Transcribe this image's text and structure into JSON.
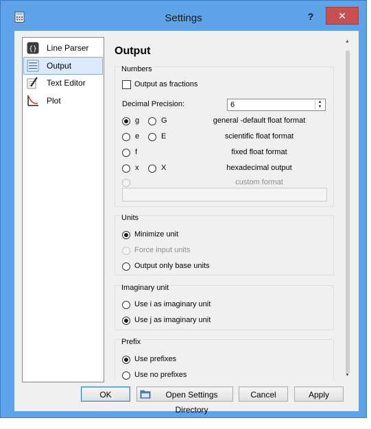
{
  "window": {
    "title": "Settings",
    "help_label": "?",
    "close_label": "✕"
  },
  "sidebar": {
    "items": [
      {
        "label": "Line Parser",
        "icon": "function-brackets-icon",
        "selected": false
      },
      {
        "label": "Output",
        "icon": "document-list-icon",
        "selected": true
      },
      {
        "label": "Text Editor",
        "icon": "pencil-paper-icon",
        "selected": false
      },
      {
        "label": "Plot",
        "icon": "graph-icon",
        "selected": false
      }
    ]
  },
  "main": {
    "title": "Output",
    "numbers": {
      "group_label": "Numbers",
      "fractions_label": "Output as fractions",
      "fractions_checked": false,
      "precision_label": "Decimal Precision:",
      "precision_value": "6",
      "formats": [
        {
          "lower": "g",
          "upper": "G",
          "desc": "general -default float format",
          "selected": "g"
        },
        {
          "lower": "e",
          "upper": "E",
          "desc": "scientific float format"
        },
        {
          "lower": "f",
          "upper": "",
          "desc": "fixed float format"
        },
        {
          "lower": "x",
          "upper": "X",
          "desc": "hexadecimal output"
        }
      ],
      "custom_label": "custom format"
    },
    "units": {
      "group_label": "Units",
      "options": [
        "Minimize unit",
        "Force input units",
        "Output only base units"
      ],
      "selected_index": 0
    },
    "imaginary": {
      "group_label": "Imaginary unit",
      "options": [
        "Use i as imaginary unit",
        "Use j as imaginary unit"
      ],
      "selected_index": 1
    },
    "prefix": {
      "group_label": "Prefix",
      "options": [
        "Use prefixes",
        "Use no prefixes"
      ],
      "selected_index": 0
    }
  },
  "buttons": {
    "ok": "OK",
    "open_dir": "Open Settings Directory",
    "cancel": "Cancel",
    "apply": "Apply"
  },
  "colors": {
    "frame": "#5ea3e8",
    "close": "#c75050",
    "selection": "#dbe9fb"
  }
}
